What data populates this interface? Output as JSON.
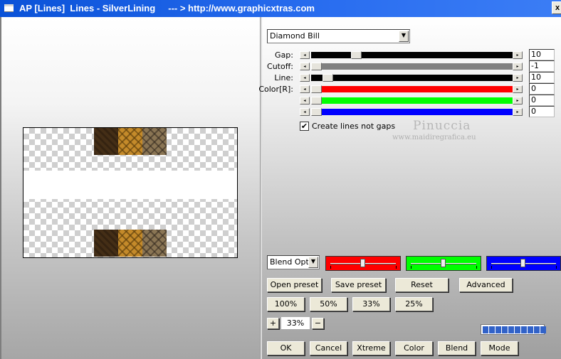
{
  "window": {
    "title": "AP [Lines]  Lines - SilverLining     --- > http://www.graphicxtras.com",
    "close_label": "x"
  },
  "preset": {
    "selected": "Diamond Bill",
    "arrow": "▼"
  },
  "sliders": [
    {
      "label": "Gap:",
      "value": "10",
      "track_color": "#000000",
      "level": 0.21
    },
    {
      "label": "Cutoff:",
      "value": "-1",
      "track_color": "#808080",
      "level": 0.0
    },
    {
      "label": "Line:",
      "value": "10",
      "track_color": "#000000",
      "level": 0.06
    },
    {
      "label": "Color[R]:",
      "value": "0",
      "track_color": "#ff0000",
      "level": 0.0
    },
    {
      "label": "",
      "value": "0",
      "track_color": "#00ff00",
      "level": 0.0
    },
    {
      "label": "",
      "value": "0",
      "track_color": "#0000ff",
      "level": 0.0
    }
  ],
  "options": {
    "create_lines_checked": true,
    "create_lines_label": "Create lines not gaps",
    "check_mark": "✔"
  },
  "watermark": {
    "name": "Pinuccia",
    "site": "www.maidiregrafica.eu"
  },
  "blend": {
    "dropdown_label": "Blend Optio",
    "bars": [
      {
        "color": "#ff0000",
        "level": 0.48
      },
      {
        "color": "#00ff00",
        "level": 0.48
      },
      {
        "color": "#0000ff",
        "level": 0.48
      }
    ]
  },
  "buttons": {
    "open_preset": "Open preset",
    "save_preset": "Save preset",
    "reset": "Reset",
    "advanced": "Advanced",
    "zoom100": "100%",
    "zoom50": "50%",
    "zoom33": "33%",
    "zoom25": "25%",
    "zoom_in": "+",
    "zoom_out": "−",
    "ok": "OK",
    "cancel": "Cancel",
    "xtreme": "Xtreme",
    "color": "Color",
    "blend": "Blend",
    "mode": "Mode"
  },
  "zoom": {
    "value": "33%"
  },
  "progress": {
    "blocks_filled": 10
  },
  "colors": {
    "titlebar": "#0a52d8",
    "button_face": "#ece9d8",
    "progress": "#3162c8"
  }
}
